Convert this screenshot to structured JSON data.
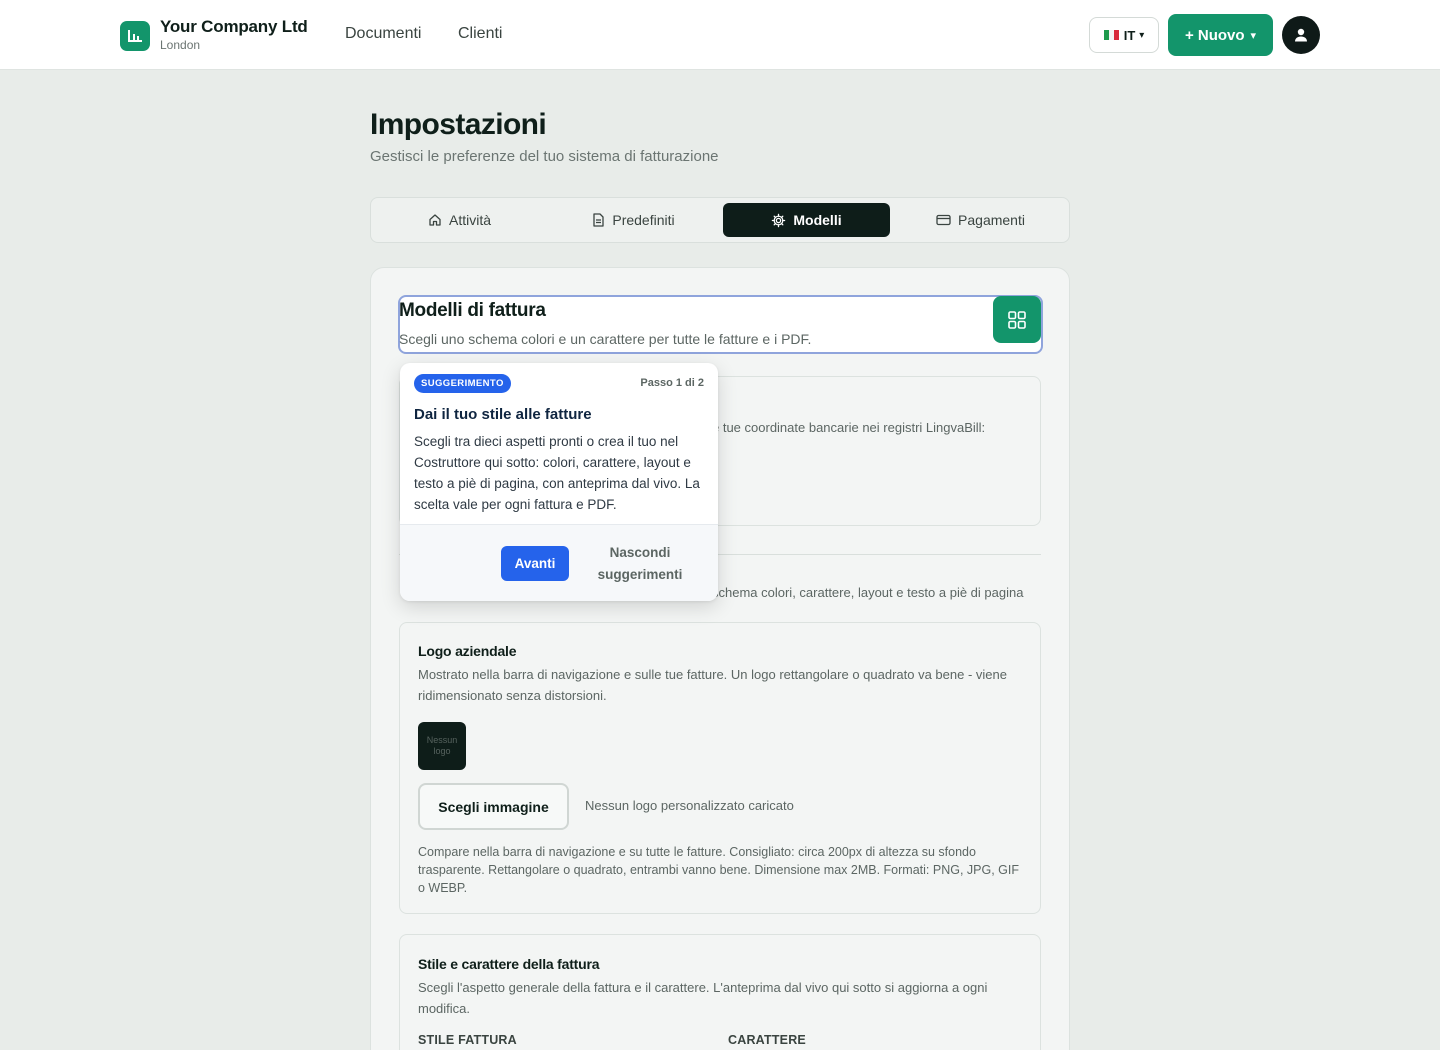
{
  "header": {
    "company_name": "Your Company Ltd",
    "company_city": "London",
    "nav": [
      "Documenti",
      "Clienti"
    ],
    "language": "IT",
    "new_button": "+ Nuovo",
    "brand_color": "#13956b"
  },
  "page": {
    "title": "Impostazioni",
    "subtitle": "Gestisci le preferenze del tuo sistema di fatturazione"
  },
  "tabs": [
    {
      "label": "Attività",
      "icon": "home-icon",
      "active": false
    },
    {
      "label": "Predefiniti",
      "icon": "document-icon",
      "active": false
    },
    {
      "label": "Modelli",
      "icon": "gear-icon",
      "active": true
    },
    {
      "label": "Pagamenti",
      "icon": "card-icon",
      "active": false
    }
  ],
  "card": {
    "title": "Modelli di fattura",
    "subtitle": "Scegli uno schema colori e un carattere per tutte le fatture e i PDF.",
    "behind_bank_text": "e tue coordinate bancarie nei registri LingvaBill:",
    "behind_style_text": "schema colori, carattere, layout e testo a piè di pagina"
  },
  "logo_section": {
    "title": "Logo aziendale",
    "description": "Mostrato nella barra di navigazione e sulle tue fatture. Un logo rettangolare o quadrato va bene - viene ridimensionato senza distorsioni.",
    "placeholder": "Nessun logo",
    "choose_button": "Scegli immagine",
    "status": "Nessun logo personalizzato caricato",
    "hint": "Compare nella barra di navigazione e su tutte le fatture. Consigliato: circa 200px di altezza su sfondo trasparente. Rettangolare o quadrato, entrambi vanno bene. Dimensione max 2MB. Formati: PNG, JPG, GIF o WEBP."
  },
  "style_section": {
    "title": "Stile e carattere della fattura",
    "description": "Scegli l'aspetto generale della fattura e il carattere. L'anteprima dal vivo qui sotto si aggiorna a ogni modifica.",
    "style_label": "STILE FATTURA",
    "font_label": "CARATTERE"
  },
  "tooltip": {
    "badge": "SUGGERIMENTO",
    "step": "Passo 1 di 2",
    "title": "Dai il tuo stile alle fatture",
    "body": "Scegli tra dieci aspetti pronti o crea il tuo nel Costruttore qui sotto: colori, carattere, layout e testo a piè di pagina, con anteprima dal vivo. La scelta vale per ogni fattura e PDF.",
    "next_button": "Avanti",
    "hide_button": "Nascondi suggerimenti"
  }
}
